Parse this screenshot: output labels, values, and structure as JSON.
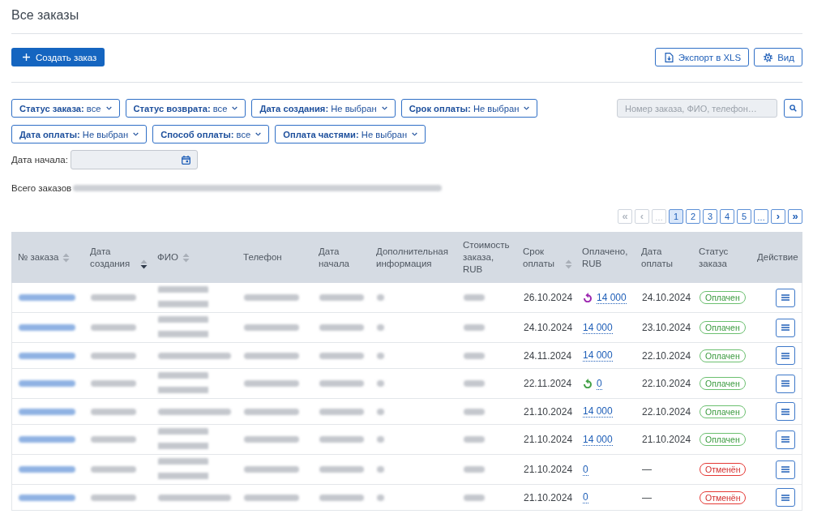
{
  "page": {
    "title": "Все заказы"
  },
  "actions": {
    "create": "Создать заказ",
    "export": "Экспорт в XLS",
    "view": "Вид"
  },
  "filters": [
    {
      "text": "**Статус заказа:** все"
    },
    {
      "text": "**Статус возврата:** все"
    },
    {
      "text": "**Дата создания:** Не выбран"
    },
    {
      "text": "**Срок оплаты:** Не выбран"
    },
    {
      "text": "**Дата оплаты:** Не выбран"
    },
    {
      "text": "**Способ оплаты:** все"
    },
    {
      "text": "**Оплата частями:** Не выбран"
    }
  ],
  "search": {
    "placeholder": "Номер заказа, ФИО, телефон…"
  },
  "start_date": {
    "label": "Дата начала:"
  },
  "summary": {
    "label": "Всего заказов",
    "blurred": true
  },
  "pagination": [
    {
      "kind": "first",
      "label": "«",
      "selected": false,
      "disabled": true
    },
    {
      "kind": "prev",
      "label": "‹",
      "selected": false,
      "disabled": true
    },
    {
      "kind": "ellipsis",
      "label": "…",
      "selected": false,
      "disabled": true
    },
    {
      "kind": "page",
      "label": "1",
      "selected": true,
      "disabled": false
    },
    {
      "kind": "page",
      "label": "2",
      "selected": false,
      "disabled": false
    },
    {
      "kind": "page",
      "label": "3",
      "selected": false,
      "disabled": false
    },
    {
      "kind": "page",
      "label": "4",
      "selected": false,
      "disabled": false
    },
    {
      "kind": "page",
      "label": "5",
      "selected": false,
      "disabled": false
    },
    {
      "kind": "ellipsis",
      "label": "…",
      "selected": false,
      "disabled": false
    },
    {
      "kind": "next",
      "label": "›",
      "selected": false,
      "disabled": false
    },
    {
      "kind": "last",
      "label": "»",
      "selected": false,
      "disabled": false
    }
  ],
  "table": {
    "columns": [
      {
        "kind": "order",
        "label": "№ заказа",
        "sortable": true,
        "sorted": false,
        "blurred": true
      },
      {
        "kind": "created",
        "label": "Дата создания",
        "sortable": true,
        "sorted": true,
        "blurred": true
      },
      {
        "kind": "name",
        "label": "ФИО",
        "sortable": true,
        "sorted": false,
        "blurred": true
      },
      {
        "kind": "phone",
        "label": "Телефон",
        "blurred": true
      },
      {
        "kind": "start",
        "label": "Дата начала",
        "blurred": true
      },
      {
        "kind": "extra",
        "label": "Дополнительная информация",
        "blurred": true
      },
      {
        "kind": "cost",
        "label": "Стоимость заказа, RUB",
        "blurred": true
      },
      {
        "kind": "due",
        "label": "Срок оплаты",
        "sortable": true,
        "sorted": false
      },
      {
        "kind": "paid",
        "label": "Оплачено, RUB"
      },
      {
        "kind": "paid_date",
        "label": "Дата оплаты"
      },
      {
        "kind": "status",
        "label": "Статус заказа"
      },
      {
        "kind": "action",
        "label": "Действие"
      }
    ],
    "rows": [
      {
        "name_wrapped": true,
        "due": "26.10.2024",
        "paid": {
          "amount": "14 000",
          "refund": {
            "color": "#9c27b0"
          }
        },
        "paid_date": "24.10.2024",
        "status": {
          "label": "Оплачен",
          "kind": "paid"
        }
      },
      {
        "name_wrapped": true,
        "due": "24.10.2024",
        "paid": {
          "amount": "14 000"
        },
        "paid_date": "23.10.2024",
        "status": {
          "label": "Оплачен",
          "kind": "paid"
        }
      },
      {
        "name_wrapped": false,
        "due": "24.11.2024",
        "paid": {
          "amount": "14 000"
        },
        "paid_date": "22.10.2024",
        "status": {
          "label": "Оплачен",
          "kind": "paid"
        }
      },
      {
        "name_wrapped": true,
        "due": "22.11.2024",
        "paid": {
          "amount": "0",
          "refund": {
            "color": "#43a047"
          }
        },
        "paid_date": "22.10.2024",
        "status": {
          "label": "Оплачен",
          "kind": "paid"
        }
      },
      {
        "name_wrapped": false,
        "due": "21.10.2024",
        "paid": {
          "amount": "14 000"
        },
        "paid_date": "22.10.2024",
        "status": {
          "label": "Оплачен",
          "kind": "paid"
        }
      },
      {
        "name_wrapped": true,
        "due": "21.10.2024",
        "paid": {
          "amount": "14 000"
        },
        "paid_date": "21.10.2024",
        "status": {
          "label": "Оплачен",
          "kind": "paid"
        }
      },
      {
        "name_wrapped": true,
        "due": "21.10.2024",
        "paid": {
          "amount": "0"
        },
        "paid_date": "—",
        "status": {
          "label": "Отменён",
          "kind": "cancelled"
        }
      },
      {
        "name_wrapped": false,
        "due": "21.10.2024",
        "paid": {
          "amount": "0"
        },
        "paid_date": "—",
        "status": {
          "label": "Отменён",
          "kind": "cancelled"
        }
      }
    ]
  }
}
